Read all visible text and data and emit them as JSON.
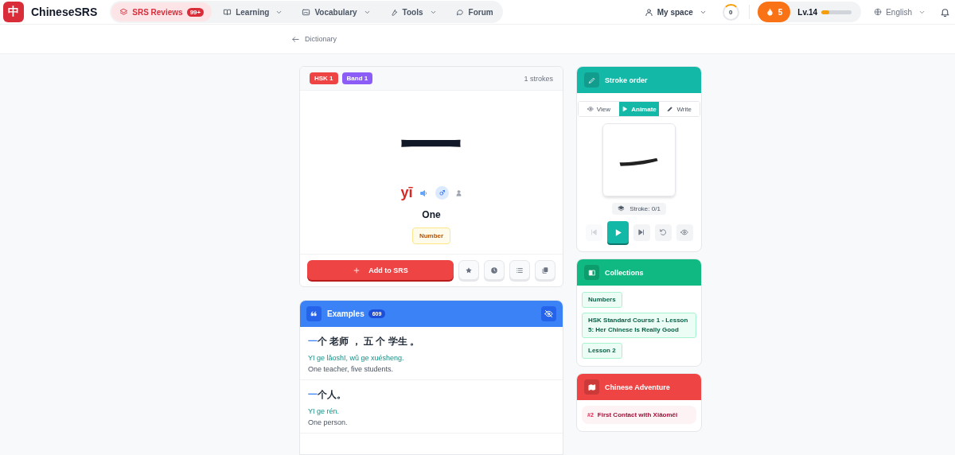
{
  "brand": {
    "logo": "中",
    "name": "ChineseSRS"
  },
  "nav": [
    {
      "label": "SRS Reviews",
      "badge": "99+",
      "selected": true,
      "dropdown": false
    },
    {
      "label": "Learning",
      "selected": false,
      "dropdown": true
    },
    {
      "label": "Vocabulary",
      "selected": false,
      "dropdown": true
    },
    {
      "label": "Tools",
      "selected": false,
      "dropdown": true
    },
    {
      "label": "Forum",
      "selected": false,
      "dropdown": false
    }
  ],
  "user_menu": {
    "label": "My space"
  },
  "review_counter": {
    "value": "0"
  },
  "streak": {
    "value": "5"
  },
  "level_meter": {
    "label": "Lv.14",
    "level": 0.25
  },
  "language": {
    "label": "English"
  },
  "breadcrumb": {
    "label": "Dictionary"
  },
  "word": {
    "tags": [
      {
        "label": "HSK 1",
        "color": "#ef4444"
      },
      {
        "label": "Band 1",
        "color": "#8b5cf6"
      }
    ],
    "strokes": "1 strokes",
    "hanzi": "一",
    "pinyin": "yī",
    "meaning": "One",
    "category": "Number",
    "primary_action": "Add to SRS"
  },
  "examples": {
    "title": "Examples",
    "count": "609",
    "items": [
      {
        "highlight": "一",
        "rest": "个 老师 ， 五 个 学生 。",
        "pinyin": "Yī ge lǎoshī, wǔ ge xuésheng.",
        "translation": "One teacher, five students."
      },
      {
        "highlight": "一",
        "rest": "个人。",
        "pinyin": "Yī ge rén.",
        "translation": "One person."
      }
    ]
  },
  "stroke_order": {
    "title": "Stroke order",
    "tabs": [
      {
        "label": "View",
        "selected": false
      },
      {
        "label": "Animate",
        "selected": true
      },
      {
        "label": "Write",
        "selected": false
      }
    ],
    "counter": "Stroke: 0/1"
  },
  "collections": {
    "title": "Collections",
    "items": [
      "Numbers",
      "HSK Standard Course 1 - Lesson 5: Her Chinese Is Really Good",
      "Lesson 2"
    ]
  },
  "adventure": {
    "title": "Chinese Adventure",
    "items": [
      {
        "number": "#2",
        "title": "First Contact with Xiǎoměi"
      }
    ]
  }
}
